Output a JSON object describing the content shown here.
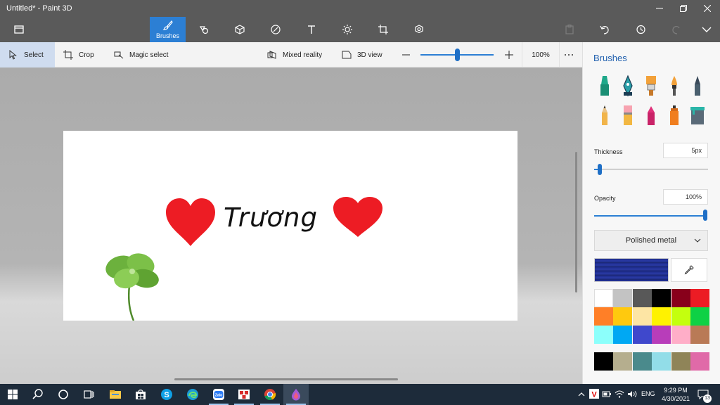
{
  "window": {
    "title": "Untitled* - Paint 3D"
  },
  "ribbon": {
    "brushes_label": "Brushes"
  },
  "subbar": {
    "select_label": "Select",
    "crop_label": "Crop",
    "magic_select_label": "Magic select",
    "mixed_reality_label": "Mixed reality",
    "view3d_label": "3D view",
    "zoom_value": "100%",
    "zoom_level_fraction": 0.5
  },
  "canvas": {
    "text": "Trương",
    "stickers": [
      "red-heart",
      "red-heart",
      "four-leaf-clover"
    ]
  },
  "panel": {
    "title": "Brushes",
    "brushes": [
      "marker-icon",
      "calligraphy-pen-icon",
      "oil-brush-icon",
      "watercolor-icon",
      "pixel-pen-icon",
      "pencil-icon",
      "eraser-icon",
      "crayon-icon",
      "spray-can-icon",
      "fill-icon"
    ],
    "thickness_label": "Thickness",
    "thickness_value": "5px",
    "opacity_label": "Opacity",
    "opacity_value": "100%",
    "material": "Polished metal",
    "current_color": "#24339a",
    "palette": [
      "#ffffff",
      "#c3c3c3",
      "#585858",
      "#000000",
      "#88001b",
      "#ec1c24",
      "#ff7f27",
      "#ffc90e",
      "#fde5a4",
      "#fff200",
      "#c4ff0e",
      "#0ed145",
      "#8cfffb",
      "#00a8f3",
      "#3f48cc",
      "#b83dba",
      "#ffaec8",
      "#b97a56"
    ],
    "custom_colors": [
      "#000000",
      "#b5ae8e",
      "#4a8a8c",
      "#92dde8",
      "#8f8458",
      "#e06aa8"
    ]
  },
  "taskbar": {
    "icons": [
      "windows-start-icon",
      "search-icon",
      "cortana-icon",
      "task-view-icon",
      "file-explorer-icon",
      "store-icon",
      "skype-icon",
      "edge-icon",
      "zalo-icon",
      "app-icon",
      "chrome-icon",
      "paint3d-icon"
    ],
    "language": "ENG",
    "time": "9:29 PM",
    "date": "4/30/2021",
    "notifications": "13"
  }
}
